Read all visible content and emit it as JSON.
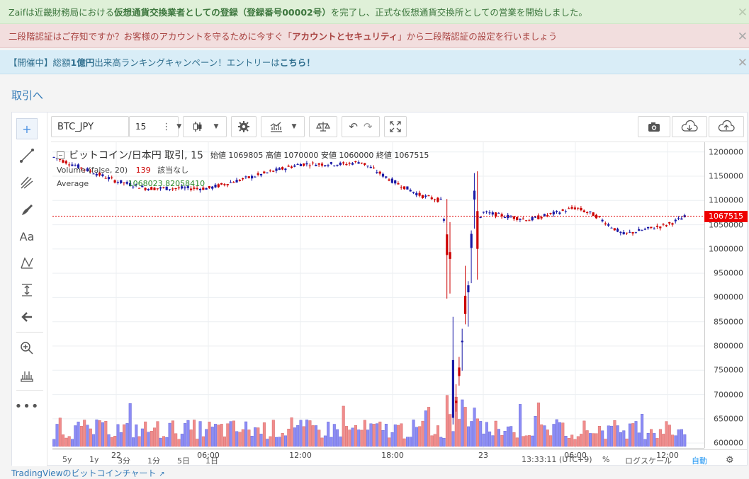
{
  "banners": {
    "registration": {
      "pre": "Zaifは近畿財務局における",
      "bold": "仮想通貨交換業者としての登録（登録番号00002号）",
      "post": "を完了し、正式な仮想通貨交換所としての営業を開始しました。"
    },
    "twofactor": {
      "pre": "二段階認証はご存知ですか？お客様のアカウントを守るために今すぐ「",
      "bold": "アカウントとセキュリティ",
      "post": "」から二段階認証の設定を行いましょう"
    },
    "campaign": {
      "pre": "【開催中】総額",
      "bold1": "1億円",
      "mid": "出来高ランキングキャンペーン！エントリーは",
      "bold2": "こちら！"
    },
    "close_glyph": "✕"
  },
  "back_link": "取引へ",
  "toolbar": {
    "symbol": "BTC_JPY",
    "interval": "15"
  },
  "legend": {
    "title": "ビットコイン/日本円 取引, 15",
    "ohlc": "始値 1069805 高値 1070000 安値 1060000 終値 1067515",
    "volume_label": "Volume (false, 20)",
    "volume_value": "139",
    "volume_na": "該当なし",
    "average_label": "Average",
    "average_value": "1068023.82058410"
  },
  "last_price_label": "1067515",
  "bottom_bar": {
    "ranges": [
      "5y",
      "1y",
      "3分",
      "1分",
      "5日",
      "1日"
    ],
    "clock": "13:33:11 (UTC+9)",
    "percent": "%",
    "log": "ログスケール",
    "auto": "自動"
  },
  "footer_link": "TradingViewのビットコインチャート",
  "colors": {
    "up": "#1a1aa6",
    "down": "#cc0000",
    "vol_up": "#8c8cf5",
    "vol_down": "#f08c8c",
    "grid": "#eceff2",
    "last_price": "#e00000"
  },
  "chart_data": {
    "type": "candlestick",
    "symbol": "BTC_JPY",
    "interval_minutes": 15,
    "ylim": [
      590000,
      1220000
    ],
    "yticks": [
      600000,
      650000,
      700000,
      750000,
      800000,
      850000,
      900000,
      950000,
      1000000,
      1050000,
      1100000,
      1150000,
      1200000
    ],
    "xticks": [
      "22",
      "06:00",
      "12:00",
      "18:00",
      "23",
      "06:00",
      "12:00"
    ],
    "last_price": 1067515,
    "close_path": [
      {
        "t": "18:00",
        "close": 1190000
      },
      {
        "t": "22 00:00",
        "close": 1140000
      },
      {
        "t": "22 03:00",
        "close": 1125000
      },
      {
        "t": "22 06:00",
        "close": 1125000
      },
      {
        "t": "22 09:00",
        "close": 1150000
      },
      {
        "t": "22 12:00",
        "close": 1175000
      },
      {
        "t": "22 15:00",
        "close": 1175000
      },
      {
        "t": "22 16:00",
        "close": 1180000
      },
      {
        "t": "22 18:00",
        "close": 1140000
      },
      {
        "t": "22 20:00",
        "close": 1110000
      },
      {
        "t": "22 21:00",
        "close": 1100000
      },
      {
        "t": "22 21:30",
        "close": 990000
      },
      {
        "t": "22 22:00",
        "close": 640000
      },
      {
        "t": "22 22:30",
        "close": 900000
      },
      {
        "t": "22 23:00",
        "close": 1040000
      },
      {
        "t": "23 00:00",
        "close": 1075000
      },
      {
        "t": "23 03:00",
        "close": 1060000
      },
      {
        "t": "23 06:00",
        "close": 1085000
      },
      {
        "t": "23 08:00",
        "close": 1070000
      },
      {
        "t": "23 10:00",
        "close": 1030000
      },
      {
        "t": "23 12:00",
        "close": 1050000
      },
      {
        "t": "23 13:30",
        "close": 1067515
      }
    ]
  }
}
